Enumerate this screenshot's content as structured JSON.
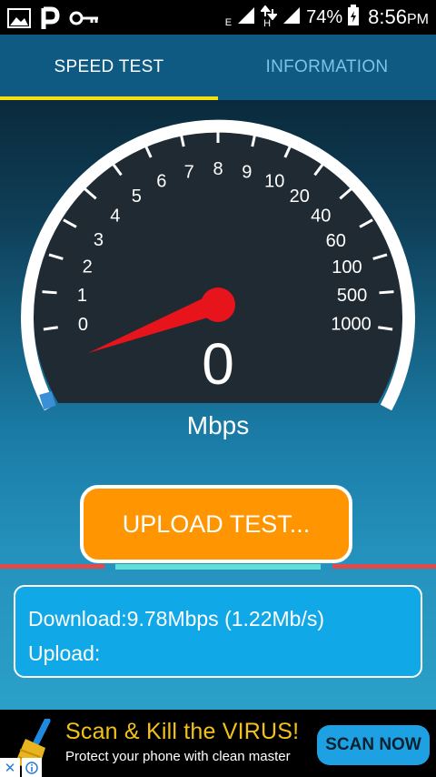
{
  "status_bar": {
    "network_label": "E",
    "network_label_2": "H",
    "battery_percent": "74%",
    "time": "8:56",
    "time_suffix": "PM"
  },
  "tabs": [
    {
      "label": "SPEED TEST",
      "active": true
    },
    {
      "label": "INFORMATION",
      "active": false
    }
  ],
  "gauge": {
    "left_labels": [
      "0",
      "1",
      "2",
      "3",
      "4",
      "5",
      "6",
      "7",
      "8"
    ],
    "right_labels": [
      "9",
      "10",
      "20",
      "40",
      "60",
      "100",
      "500",
      "1000"
    ],
    "current_value": "0",
    "unit": "Mbps",
    "arc_progress_fraction": 0.02
  },
  "upload_button": {
    "label": "UPLOAD TEST..."
  },
  "results": {
    "download": "Download:9.78Mbps (1.22Mb/s)",
    "upload": "Upload:"
  },
  "ad": {
    "title": "Scan & Kill the VIRUS!",
    "subtitle": "Protect your phone with clean master",
    "cta": "SCAN NOW"
  },
  "colors": {
    "tab_bar": "#0f5a82",
    "tab_indicator": "#f2e10e",
    "upload_button": "#ff9500",
    "results_panel": "#11a8e8",
    "needle": "#e8141c",
    "ad_title": "#f3c21a",
    "ad_button": "#1da1e3"
  }
}
